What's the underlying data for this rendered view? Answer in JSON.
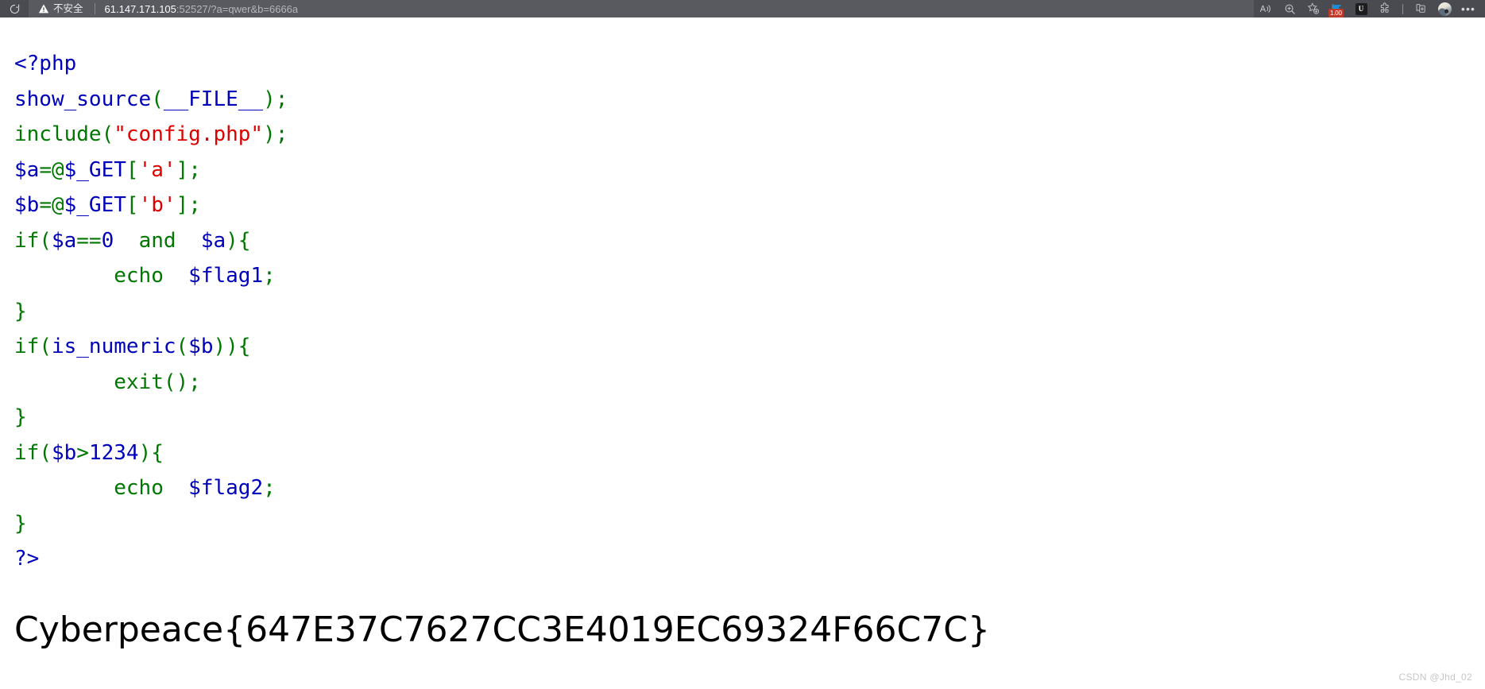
{
  "browser": {
    "reload_label": "Reload",
    "security": {
      "icon": "warning-triangle-icon",
      "text": "不安全"
    },
    "url": {
      "host": "61.147.171.105",
      "rest": ":52527/?a=qwer&b=6666a",
      "full": "61.147.171.105:52527/?a=qwer&b=6666a"
    },
    "toolbar": [
      {
        "name": "read-aloud-icon",
        "label": "朗读此页内容"
      },
      {
        "name": "zoom-icon",
        "label": "缩放"
      },
      {
        "name": "add-favorite-icon",
        "label": "添加到收藏夹"
      },
      {
        "name": "extension-flag-icon",
        "label": "扩展",
        "badge": "1.00"
      },
      {
        "name": "extension-u-icon",
        "label": "U",
        "glyph": "U"
      },
      {
        "name": "extensions-puzzle-icon",
        "label": "扩展"
      },
      {
        "name": "collections-icon",
        "label": "收藏集"
      },
      {
        "name": "profile-avatar",
        "label": "个人资料"
      },
      {
        "name": "settings-more-icon",
        "label": "设置及其他",
        "glyph": "•••"
      }
    ]
  },
  "code": {
    "language": "php",
    "lines": [
      [
        {
          "t": "<?php",
          "c": "c-default"
        }
      ],
      [
        {
          "t": "show_source",
          "c": "c-default"
        },
        {
          "t": "(",
          "c": "c-kw"
        },
        {
          "t": "__FILE__",
          "c": "c-default"
        },
        {
          "t": ")",
          "c": "c-kw"
        },
        {
          "t": ";",
          "c": "c-kw"
        }
      ],
      [
        {
          "t": "include",
          "c": "c-kw"
        },
        {
          "t": "(",
          "c": "c-kw"
        },
        {
          "t": "\"config.php\"",
          "c": "c-str"
        },
        {
          "t": ")",
          "c": "c-kw"
        },
        {
          "t": ";",
          "c": "c-kw"
        }
      ],
      [
        {
          "t": "$a",
          "c": "c-default"
        },
        {
          "t": "=",
          "c": "c-kw"
        },
        {
          "t": "@",
          "c": "c-kw"
        },
        {
          "t": "$_GET",
          "c": "c-default"
        },
        {
          "t": "[",
          "c": "c-kw"
        },
        {
          "t": "'a'",
          "c": "c-str"
        },
        {
          "t": "]",
          "c": "c-kw"
        },
        {
          "t": ";",
          "c": "c-kw"
        }
      ],
      [
        {
          "t": "$b",
          "c": "c-default"
        },
        {
          "t": "=",
          "c": "c-kw"
        },
        {
          "t": "@",
          "c": "c-kw"
        },
        {
          "t": "$_GET",
          "c": "c-default"
        },
        {
          "t": "[",
          "c": "c-kw"
        },
        {
          "t": "'b'",
          "c": "c-str"
        },
        {
          "t": "]",
          "c": "c-kw"
        },
        {
          "t": ";",
          "c": "c-kw"
        }
      ],
      [
        {
          "t": "if",
          "c": "c-kw"
        },
        {
          "t": "(",
          "c": "c-kw"
        },
        {
          "t": "$a",
          "c": "c-default"
        },
        {
          "t": "==",
          "c": "c-kw"
        },
        {
          "t": "0",
          "c": "c-num"
        },
        {
          "t": "  ",
          "c": "c-kw"
        },
        {
          "t": "and",
          "c": "c-kw"
        },
        {
          "t": "  ",
          "c": "c-kw"
        },
        {
          "t": "$a",
          "c": "c-default"
        },
        {
          "t": ")",
          "c": "c-kw"
        },
        {
          "t": "{",
          "c": "c-kw"
        }
      ],
      [
        {
          "t": "        ",
          "c": "c-kw"
        },
        {
          "t": "echo",
          "c": "c-kw"
        },
        {
          "t": "  ",
          "c": "c-kw"
        },
        {
          "t": "$flag1",
          "c": "c-default"
        },
        {
          "t": ";",
          "c": "c-kw"
        }
      ],
      [
        {
          "t": "}",
          "c": "c-kw"
        }
      ],
      [
        {
          "t": "if",
          "c": "c-kw"
        },
        {
          "t": "(",
          "c": "c-kw"
        },
        {
          "t": "is_numeric",
          "c": "c-default"
        },
        {
          "t": "(",
          "c": "c-kw"
        },
        {
          "t": "$b",
          "c": "c-default"
        },
        {
          "t": ")",
          "c": "c-kw"
        },
        {
          "t": ")",
          "c": "c-kw"
        },
        {
          "t": "{",
          "c": "c-kw"
        }
      ],
      [
        {
          "t": "        ",
          "c": "c-kw"
        },
        {
          "t": "exit",
          "c": "c-kw"
        },
        {
          "t": "()",
          "c": "c-kw"
        },
        {
          "t": ";",
          "c": "c-kw"
        }
      ],
      [
        {
          "t": "}",
          "c": "c-kw"
        }
      ],
      [
        {
          "t": "if",
          "c": "c-kw"
        },
        {
          "t": "(",
          "c": "c-kw"
        },
        {
          "t": "$b",
          "c": "c-default"
        },
        {
          "t": ">",
          "c": "c-kw"
        },
        {
          "t": "1234",
          "c": "c-num"
        },
        {
          "t": ")",
          "c": "c-kw"
        },
        {
          "t": "{",
          "c": "c-kw"
        }
      ],
      [
        {
          "t": "        ",
          "c": "c-kw"
        },
        {
          "t": "echo",
          "c": "c-kw"
        },
        {
          "t": "  ",
          "c": "c-kw"
        },
        {
          "t": "$flag2",
          "c": "c-default"
        },
        {
          "t": ";",
          "c": "c-kw"
        }
      ],
      [
        {
          "t": "}",
          "c": "c-kw"
        }
      ],
      [
        {
          "t": "?>",
          "c": "c-default"
        }
      ]
    ]
  },
  "output": {
    "flag": "Cyberpeace{647E37C7627CC3E4019EC69324F66C7C}"
  },
  "watermark": {
    "text": "CSDN @Jhd_02"
  }
}
